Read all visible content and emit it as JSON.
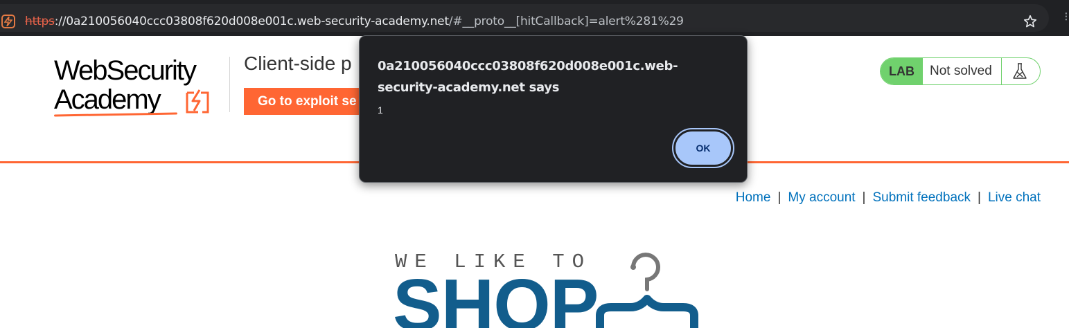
{
  "browser": {
    "url_scheme": "https",
    "url_host": "://0a210056040ccc03808f620d008e001c.web-security-academy.net",
    "url_rest": "/#__proto__[hitCallback]=alert%281%29",
    "site_icon": "lightning-icon",
    "bookmark_icon": "star-icon"
  },
  "header": {
    "logo_line1": "WebSecurity",
    "logo_line2": "Academy",
    "lab_title": "Client-side p",
    "exploit_button": "Go to exploit se",
    "lab_badge": "LAB",
    "lab_status": "Not solved",
    "flask_icon": "flask-icon"
  },
  "nav": {
    "items": [
      "Home",
      "My account",
      "Submit feedback",
      "Live chat"
    ],
    "separator": "|"
  },
  "banner": {
    "tagline": "WE LIKE TO",
    "word": "SHOP",
    "hanger_icon": "hanger-icon"
  },
  "dialog": {
    "title": "0a210056040ccc03808f620d008e001c.web-security-academy.net says",
    "message": "1",
    "ok_label": "OK"
  },
  "colors": {
    "accent": "#ff6633",
    "lab_green": "#70d16d",
    "link_blue": "#0071bc",
    "shop_blue": "#125d8c",
    "dialog_bg": "#202124",
    "ok_button": "#a8c7fa"
  }
}
